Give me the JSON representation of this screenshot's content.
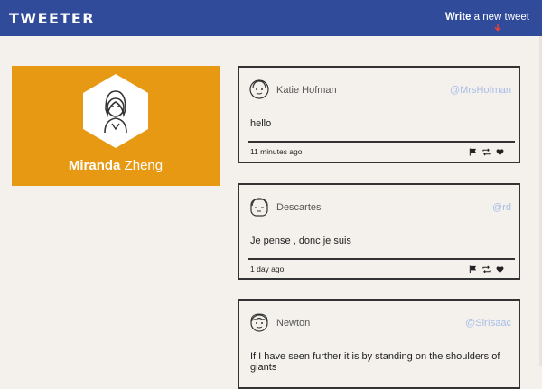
{
  "nav": {
    "brand": "TWEETER",
    "compose_bold": "Write",
    "compose_rest": " a new tweet"
  },
  "profile": {
    "first_name": "Miranda",
    "last_name": " Zheng"
  },
  "tweets": [
    {
      "name": "Katie Hofman",
      "handle": "@MrsHofman",
      "text": "hello",
      "time": "11 minutes ago"
    },
    {
      "name": "Descartes",
      "handle": "@rd",
      "text": "Je pense , donc je suis",
      "time": "1 day ago"
    },
    {
      "name": "Newton",
      "handle": "@SirIsaac",
      "text": "If I have seen further it is by standing on the shoulders of giants",
      "time": ""
    }
  ],
  "colors": {
    "nav_bg": "#2f4b9a",
    "profile_bg": "#e89914",
    "handle": "#a9bde8",
    "compose_icon": "#e0413a"
  },
  "icons": {
    "tweet_actions": [
      "flag-icon",
      "retweet-icon",
      "heart-icon"
    ],
    "compose": "arrow-down-icon"
  }
}
